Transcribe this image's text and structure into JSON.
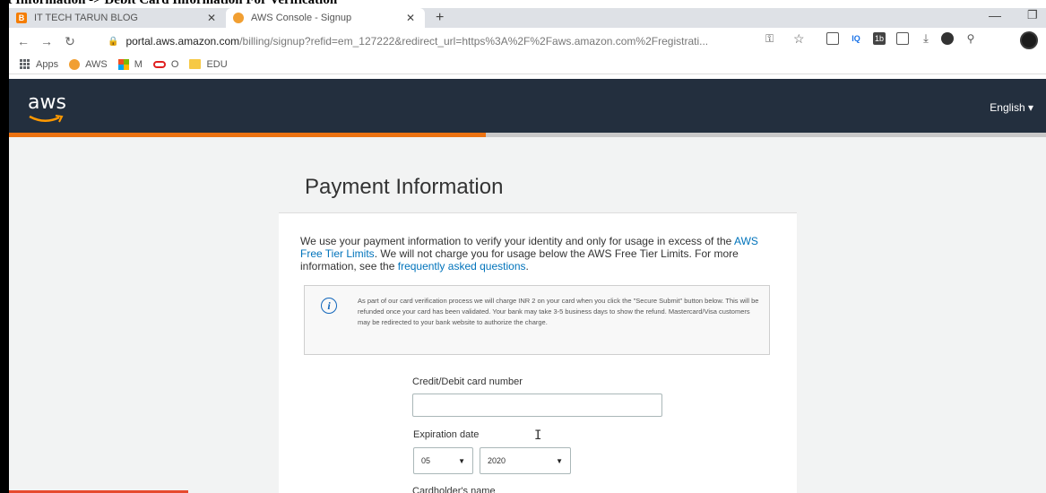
{
  "overlay": {
    "title": "nt Information -> Debit Card Information For Verification"
  },
  "browser": {
    "tabs": [
      {
        "title": "IT TECH TARUN BLOG",
        "favicon": "blogger-icon",
        "active": false
      },
      {
        "title": "AWS Console - Signup",
        "favicon": "aws-icon",
        "active": true
      }
    ],
    "new_tab": "+",
    "address": {
      "host": "portal.aws.amazon.com",
      "rest": "/billing/signup?refid=em_127222&redirect_url=https%3A%2F%2Faws.amazon.com%2Fregistrati..."
    },
    "bookmarks": [
      {
        "label": "Apps",
        "icon": "apps-grid-icon"
      },
      {
        "label": "AWS",
        "icon": "aws-icon"
      },
      {
        "label": "M",
        "icon": "microsoft-icon"
      },
      {
        "label": "O",
        "icon": "opera-icon"
      },
      {
        "label": "EDU",
        "icon": "folder-icon"
      }
    ],
    "extensions": [
      "IQ",
      "1b"
    ]
  },
  "aws": {
    "logo": "aws",
    "language": "English ▾",
    "progress_fraction": 0.46,
    "accent": "#ec7211",
    "header_bg": "#232f3e"
  },
  "payment": {
    "heading": "Payment Information",
    "intro_1": "We use your payment information to verify your identity and only for usage in excess of the ",
    "intro_link_1": "AWS Free Tier Limits",
    "intro_2": ". We will not charge you for usage below the AWS Free Tier Limits. For more information, see the ",
    "intro_link_2": "frequently asked questions",
    "intro_3": ".",
    "notice": "As part of our card verification process we will charge INR 2 on your card when you click the \"Secure Submit\" button below. This will be refunded once your card has been validated. Your bank may take 3-5 business days to show the refund. Mastercard/Visa customers may be redirected to your bank website to authorize the charge.",
    "card_number_label": "Credit/Debit card number",
    "card_number_value": "",
    "expiration_label": "Expiration date",
    "exp_month": "05",
    "exp_year": "2020",
    "cardholder_label": "Cardholder's name"
  }
}
